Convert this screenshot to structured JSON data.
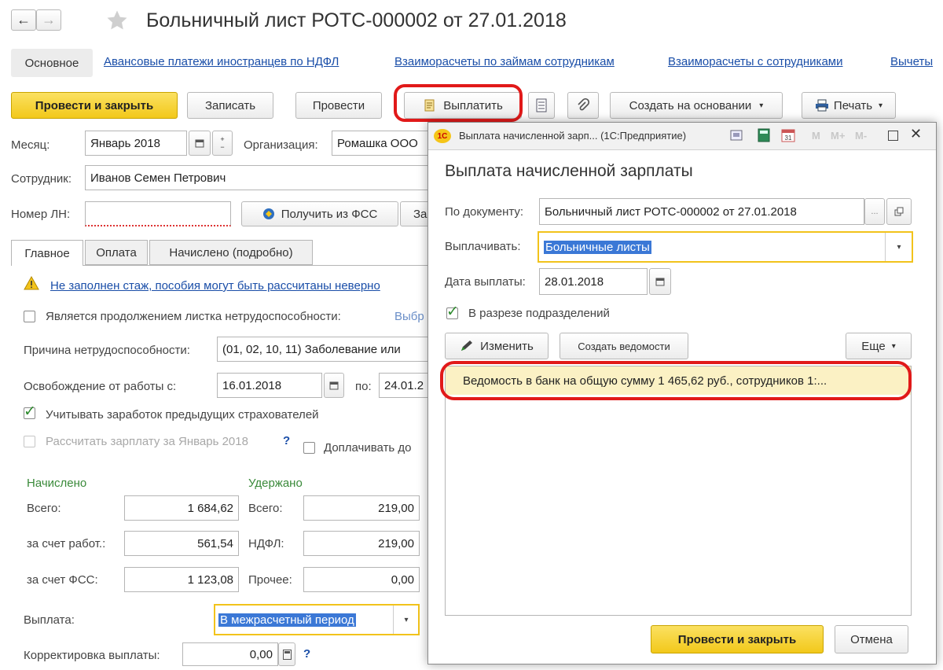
{
  "window": {
    "title": "Больничный лист РОТС-000002 от 27.01.2018"
  },
  "nav": {
    "back": "←",
    "forward": "→",
    "tabs": [
      "Основное",
      "Авансовые платежи иностранцев по НДФЛ",
      "Взаиморасчеты по займам сотрудникам",
      "Взаиморасчеты с сотрудниками",
      "Вычеты"
    ]
  },
  "toolbar": {
    "post_close": "Провести и закрыть",
    "save": "Записать",
    "post": "Провести",
    "pay": "Выплатить",
    "create_based": "Создать на основании",
    "print": "Печать"
  },
  "form": {
    "month_label": "Месяц:",
    "month_value": "Январь 2018",
    "org_label": "Организация:",
    "org_value": "Ромашка ООО",
    "employee_label": "Сотрудник:",
    "employee_value": "Иванов Семен Петрович",
    "ln_label": "Номер ЛН:",
    "ln_value": "",
    "get_fss": "Получить из ФСС",
    "get_fss_tail": "За"
  },
  "tabs": [
    "Главное",
    "Оплата",
    "Начислено (подробно)"
  ],
  "main": {
    "warning": "Не заполнен стаж, пособия могут быть рассчитаны неверно",
    "continuation_label": "Является продолжением листка нетрудоспособности:",
    "continuation_link": "Выбр",
    "reason_label": "Причина нетрудоспособности:",
    "reason_value": "(01, 02, 10, 11) Заболевание или",
    "release_label": "Освобождение от работы с:",
    "release_from": "16.01.2018",
    "to_label": "по:",
    "release_to": "24.01.2",
    "consider_prev": "Учитывать заработок предыдущих страхователей",
    "calc_salary": "Рассчитать зарплату за Январь 2018",
    "help": "?",
    "extra_pay": "Доплачивать до",
    "accrued_header": "Начислено",
    "withheld_header": "Удержано",
    "total_label": "Всего:",
    "total_value": "1 684,62",
    "w_total_label": "Всего:",
    "w_total_value": "219,00",
    "employer_label": "за счет работ.:",
    "employer_value": "561,54",
    "ndfl_label": "НДФЛ:",
    "ndfl_value": "219,00",
    "fss_label": "за счет ФСС:",
    "fss_value": "1 123,08",
    "other_label": "Прочее:",
    "other_value": "0,00",
    "payout_label": "Выплата:",
    "payout_value": "В межрасчетный период",
    "adjust_label": "Корректировка выплаты:",
    "adjust_value": "0,00"
  },
  "dialog": {
    "titlebar": "Выплата начисленной зарп... (1С:Предприятие)",
    "title": "Выплата начисленной зарплаты",
    "doc_label": "По документу:",
    "doc_value": "Больничный лист РОТС-000002 от 27.01.2018",
    "pay_label": "Выплачивать:",
    "pay_value": "Больничные листы",
    "date_label": "Дата выплаты:",
    "date_value": "28.01.2018",
    "by_dept": "В разрезе подразделений",
    "edit": "Изменить",
    "create_statements": "Создать ведомости",
    "more": "Еще",
    "row": "Ведомость в банк на общую сумму 1 465,62 руб., сотрудников 1:...",
    "post_close": "Провести  и закрыть",
    "cancel": "Отмена",
    "tb_m": "M",
    "tb_mplus": "M+",
    "tb_mminus": "M-"
  }
}
